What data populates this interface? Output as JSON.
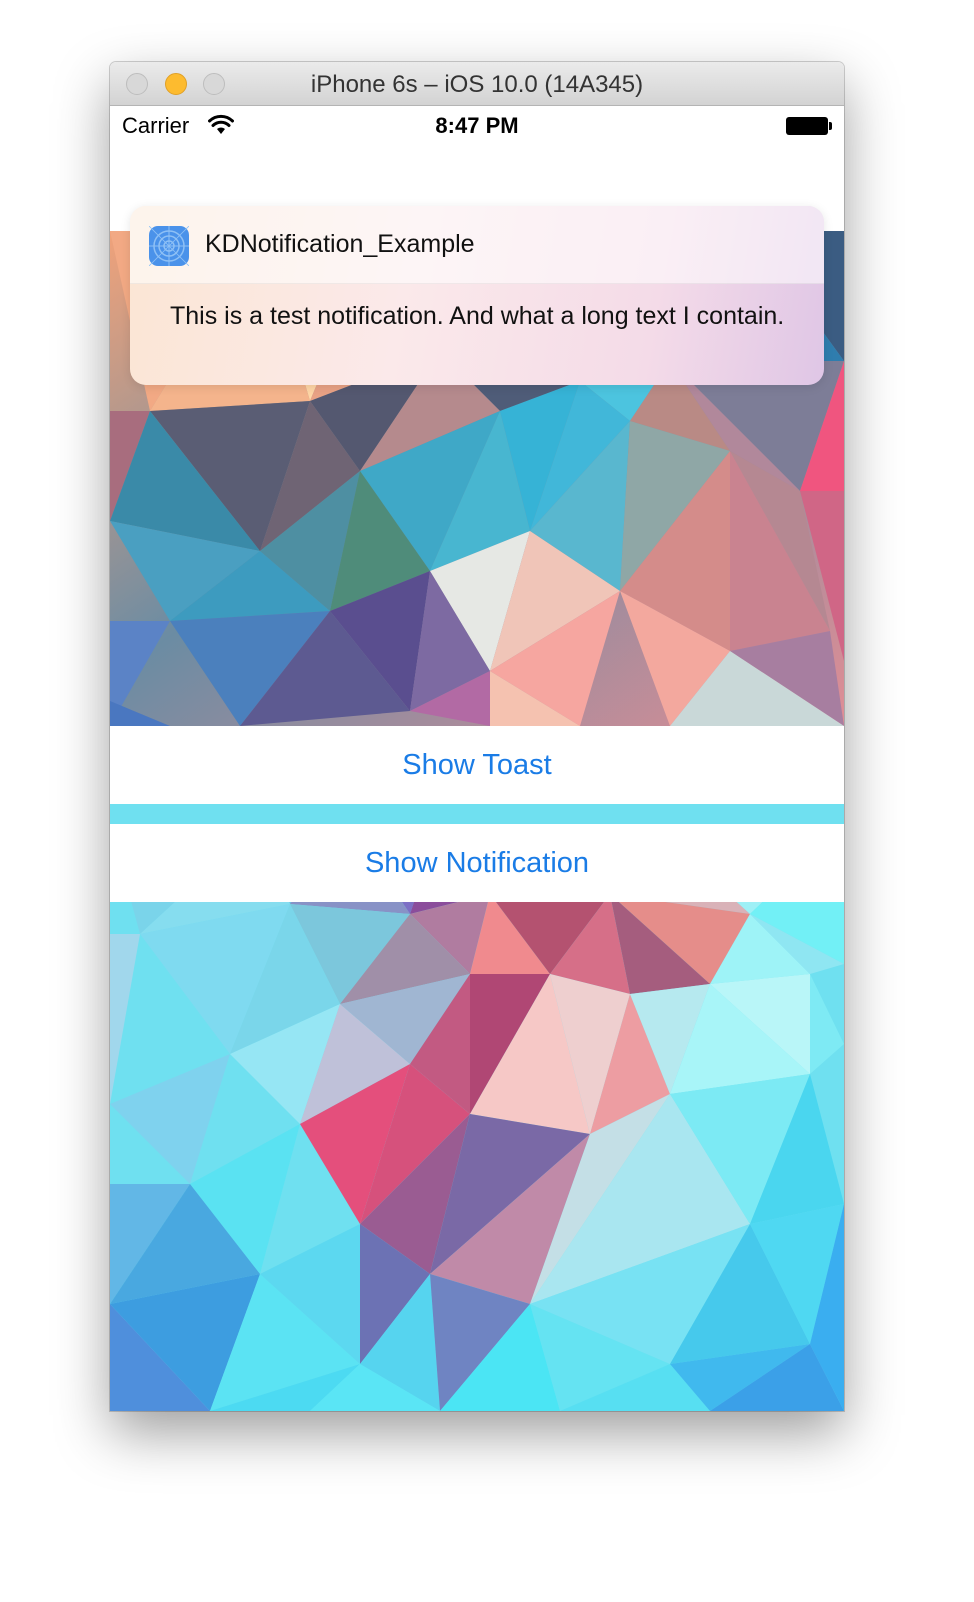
{
  "window": {
    "title": "iPhone 6s – iOS 10.0 (14A345)"
  },
  "status_bar": {
    "carrier": "Carrier",
    "time": "8:47 PM"
  },
  "notification": {
    "app_name": "KDNotification_Example",
    "message": "This is a test notification. And what a long text I contain."
  },
  "buttons": {
    "show_toast": "Show Toast",
    "show_notification": "Show Notification"
  },
  "colors": {
    "button_text": "#1a7ce6",
    "app_icon": "#4a92ea"
  },
  "icons": [
    "wifi-icon",
    "battery-icon",
    "app-icon"
  ]
}
